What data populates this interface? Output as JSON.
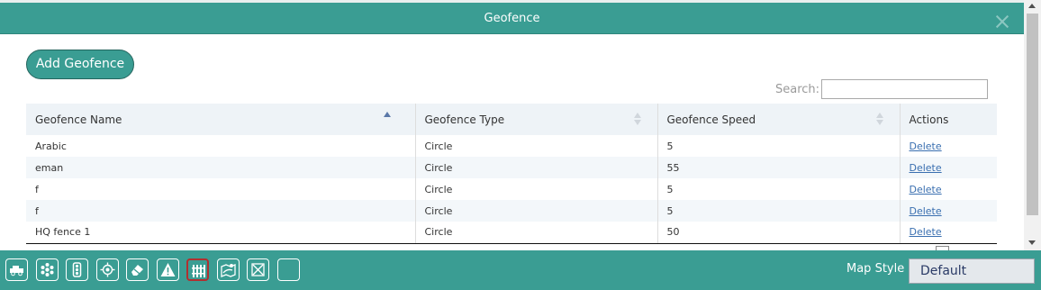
{
  "modal": {
    "title": "Geofence",
    "close_icon": "close-icon"
  },
  "actions": {
    "add_label": "Add Geofence"
  },
  "search": {
    "label": "Search:",
    "value": "",
    "placeholder": ""
  },
  "table": {
    "columns": [
      "Geofence Name",
      "Geofence Type",
      "Geofence Speed",
      "Actions"
    ],
    "sort": {
      "column": "Geofence Name",
      "direction": "ascending"
    },
    "rows": [
      {
        "name": "Arabic",
        "type": "Circle",
        "speed": "5",
        "action": "Delete"
      },
      {
        "name": "eman",
        "type": "Circle",
        "speed": "55",
        "action": "Delete"
      },
      {
        "name": "f",
        "type": "Circle",
        "speed": "5",
        "action": "Delete"
      },
      {
        "name": "f",
        "type": "Circle",
        "speed": "5",
        "action": "Delete"
      },
      {
        "name": "HQ fence 1",
        "type": "Circle",
        "speed": "50",
        "action": "Delete"
      }
    ]
  },
  "toolbar": {
    "icons": [
      "vehicle-icon",
      "cluster-icon",
      "traffic-light-icon",
      "locate-icon",
      "eraser-icon",
      "warning-icon",
      "geofence-icon",
      "map-route-icon",
      "fullscreen-icon",
      "blank-icon"
    ],
    "active_icon": "geofence-icon",
    "map_style_label": "Map Style",
    "map_style_value": "Default"
  },
  "colors": {
    "accent": "#3a9d93",
    "active_outline": "#b03030",
    "link": "#3a6fb0"
  }
}
